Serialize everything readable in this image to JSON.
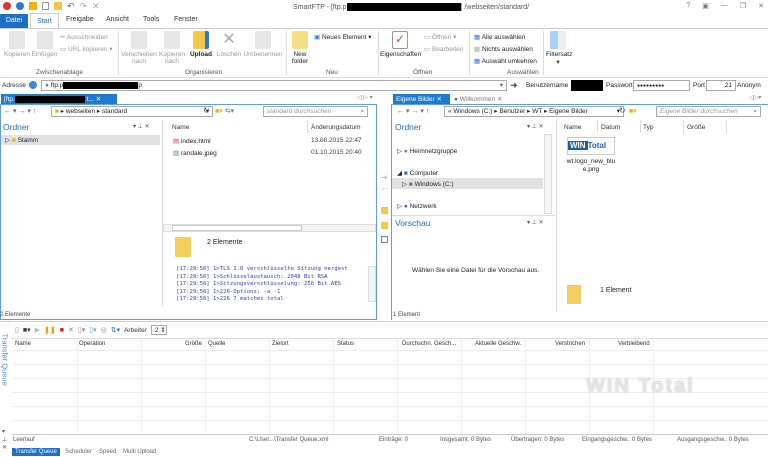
{
  "window": {
    "title_prefix": "SmartFTP - [ftp.p",
    "title_suffix": "] /webseiten/standard/",
    "controls": [
      "?",
      "▣",
      "—",
      "❐",
      "✕"
    ]
  },
  "ribbon": {
    "tabs": [
      "Datei",
      "Start",
      "Freigabe",
      "Ansicht",
      "Tools",
      "Fenster"
    ],
    "clipboard": {
      "copy": "Kopieren",
      "paste": "Einfügen",
      "cut": "Ausschneiden",
      "copy_url": "URL kopieren",
      "label": "Zwischenablage"
    },
    "organize": {
      "move": "Verschieben",
      "move2": "nach",
      "copy_to": "Kopieren",
      "copy_to2": "nach",
      "upload": "Upload",
      "delete": "Löschen",
      "rename": "Umbenennen",
      "label": "Organisieren"
    },
    "new": {
      "new_folder": "New",
      "new_folder2": "folder",
      "new_item": "Neues Element",
      "label": "Neu"
    },
    "open": {
      "properties": "Eigenschaften",
      "open": "Öffnen",
      "edit": "Bearbeiten",
      "label": "Öffnen"
    },
    "select": {
      "all": "Alle auswählen",
      "none": "Nichts auswählen",
      "invert": "Auswahl umkehren",
      "label": "Auswählen"
    },
    "filter": {
      "label": "Filtersatz"
    }
  },
  "address": {
    "label": "Adresse",
    "value_prefix": "ftp.p",
    "value_suffix": "p",
    "user_label": "Benutzername",
    "pass_label": "Passwort",
    "pass_value": "●●●●●●●●●",
    "port_label": "Port",
    "port_value": "21",
    "anon_label": "Anonym"
  },
  "left": {
    "tab_prefix": "[ftp.",
    "tab_suffix": "t...",
    "breadcrumb": [
      "webseiten",
      "standard"
    ],
    "search_placeholder": "standard durchsuchen",
    "folder_title": "Ordner",
    "tree": [
      "Stamm"
    ],
    "columns": [
      "Name",
      "Änderungsdatum"
    ],
    "files": [
      {
        "name": "index.html",
        "date": "13.08.2015 22:47"
      },
      {
        "name": "randale.jpeg",
        "date": "01.10.2015 20:40"
      }
    ],
    "info": "2 Elemente",
    "status": "2 Elemente",
    "log": [
      "[17:29:56] 1>TLS 1.0 verschlüsselte Sitzung hergest",
      "[17:29:56] 1>Schlüsselaustausch: 2048 Bit RSA",
      "[17:29:56] 1>Sitzungsverschlüsselung: 256 Bit AES",
      "[17:29:56] 1>226-Options: -a -1",
      "[17:29:56] 1>226 7 matches total"
    ]
  },
  "right": {
    "tabs": [
      "Eigene Bilder",
      "Willkommen"
    ],
    "breadcrumb": [
      "Windows (C:)",
      "Benutzer",
      "WT",
      "Eigene Bilder"
    ],
    "search_placeholder": "Eigene Bilder durchsuchen",
    "folder_title": "Ordner",
    "tree": [
      "Heimnetzgruppe",
      "Computer",
      "Windows (C:)",
      "Netzwerk"
    ],
    "preview_title": "Vorschau",
    "preview_text": "Wählen Sie eine Datei für die Vorschau aus.",
    "columns": [
      "Name",
      "Datum",
      "Typ",
      "Größe"
    ],
    "file": {
      "name": "wt.logo_new_blu e.png",
      "logo_a": "WIN",
      "logo_b": "Total"
    },
    "info": "1 Element",
    "status": "1 Element"
  },
  "queue": {
    "side_label": "Transfer Queue",
    "workers_label": "Arbeiter",
    "workers_value": "2",
    "columns": [
      "Name",
      "Operation",
      "Größe",
      "Quelle",
      "Zielort",
      "Status",
      "Durchschn. Gesch...",
      "Aktuelle Geschw.",
      "Verstrichen",
      "Verbleibend"
    ],
    "status": [
      "Leerlauf",
      "C:\\User...\\Transfer Queue.xml",
      "Einträge: 0",
      "Insgesamt: 0 Bytes",
      "Übertragen: 0 Bytes",
      "Eingangsgeschw.: 0 Bytes",
      "Ausgangsgeschw.: 0 Bytes"
    ],
    "tabs": [
      "Transfer Queue",
      "Scheduler",
      "Speed",
      "Multi Upload"
    ],
    "watermark": "WIN Total"
  }
}
